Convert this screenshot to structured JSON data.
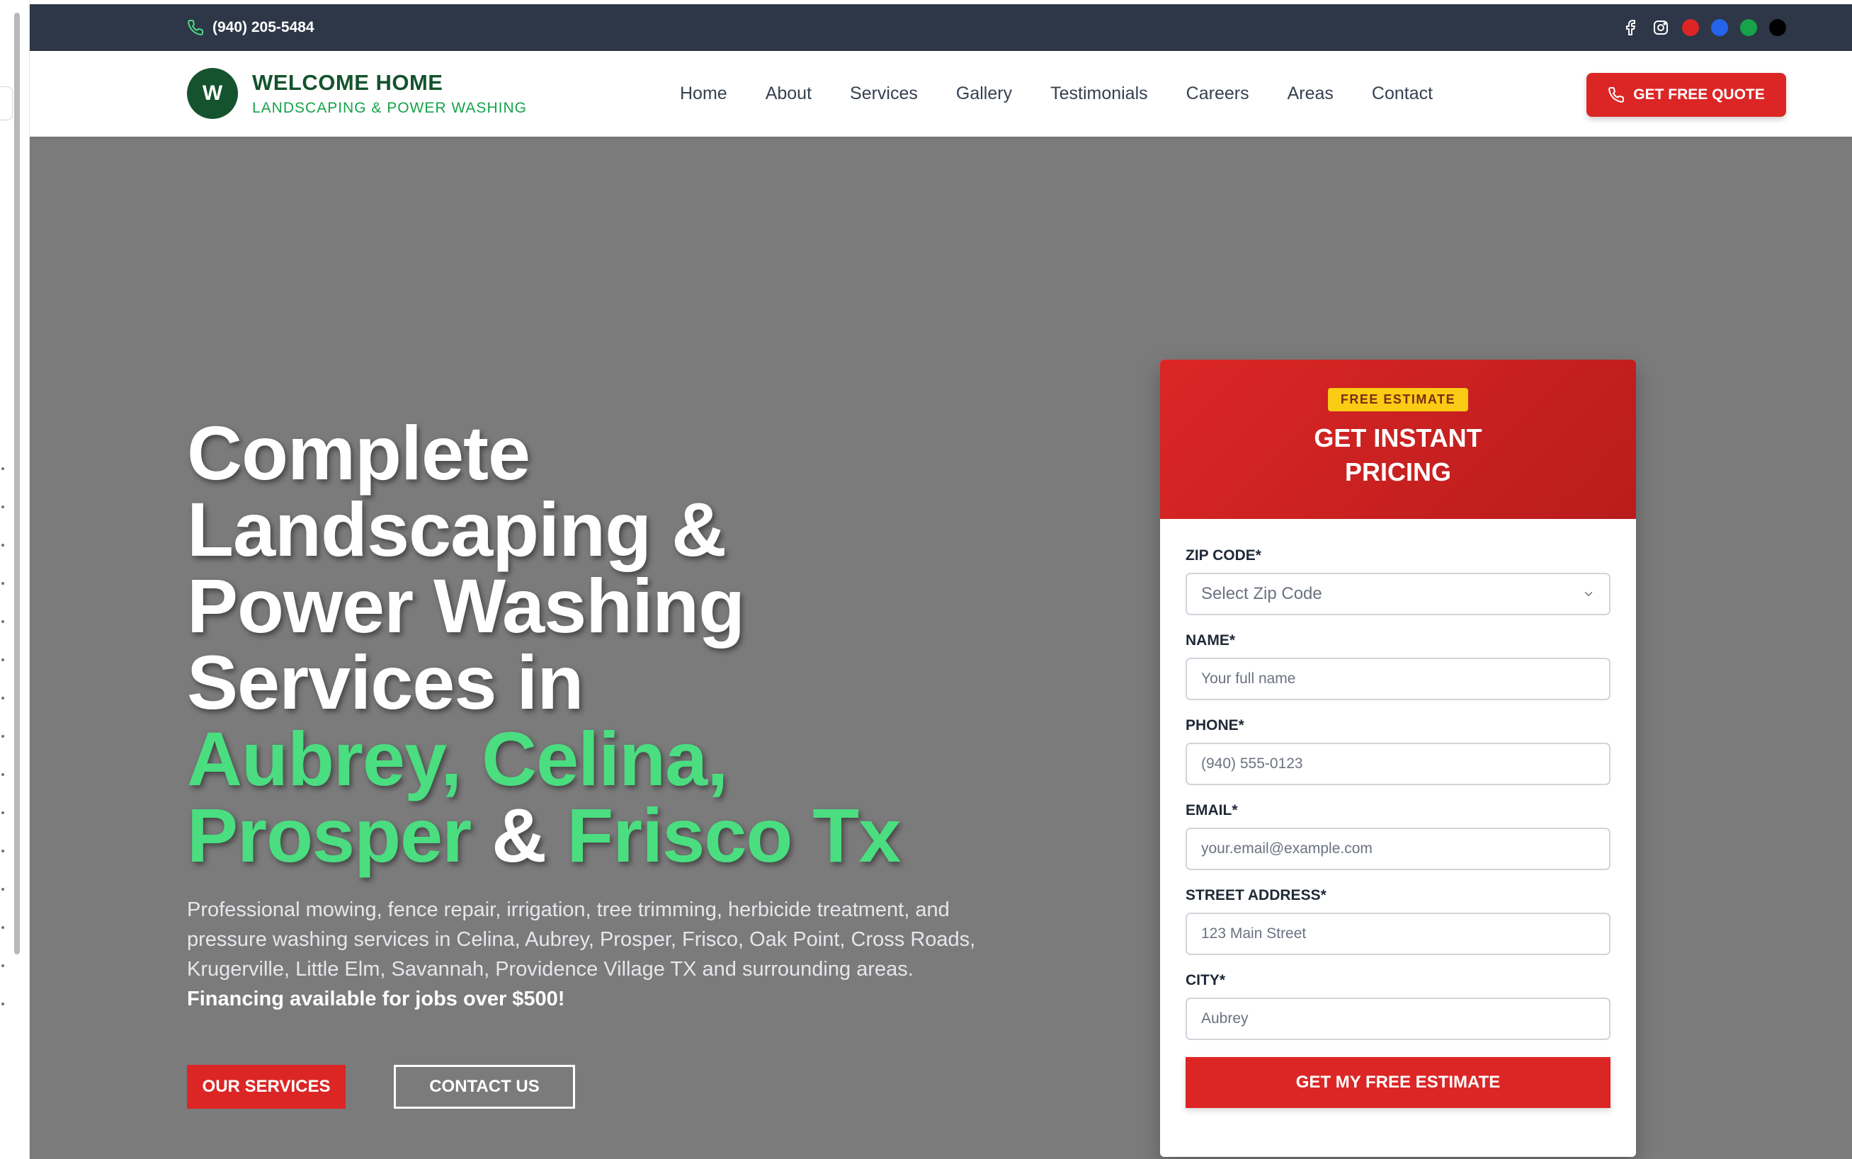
{
  "topbar": {
    "phone": "(940) 205-5484",
    "social": [
      {
        "name": "facebook-icon"
      },
      {
        "name": "instagram-icon"
      },
      {
        "name": "red-dot",
        "color": "#dc2626"
      },
      {
        "name": "blue-dot",
        "color": "#2563eb"
      },
      {
        "name": "green-dot",
        "color": "#16a34a"
      },
      {
        "name": "black-dot",
        "color": "#000000"
      }
    ]
  },
  "brand": {
    "initial": "W",
    "title": "WELCOME HOME",
    "subtitle": "LANDSCAPING & POWER WASHING"
  },
  "nav": {
    "items": [
      "Home",
      "About",
      "Services",
      "Gallery",
      "Testimonials",
      "Careers",
      "Areas",
      "Contact"
    ],
    "cta": "GET FREE QUOTE"
  },
  "hero": {
    "line1": "Complete",
    "line2": "Landscaping &",
    "line3": "Power Washing",
    "line4": "Services in",
    "green1": "Aubrey, Celina,",
    "green2": "Prosper",
    "amp": " & ",
    "green3": "Frisco Tx",
    "description": "Professional mowing, fence repair, irrigation, tree trimming, herbicide treatment, and pressure washing services in Celina, Aubrey, Prosper, Frisco, Oak Point, Cross Roads, Krugerville, Little Elm, Savannah, Providence Village TX and surrounding areas.",
    "financing": "Financing available for jobs over $500!",
    "btn_services": "OUR SERVICES",
    "btn_contact": "CONTACT US"
  },
  "estimate": {
    "badge": "FREE ESTIMATE",
    "title_line1": "GET INSTANT",
    "title_line2": "PRICING",
    "zip_label": "ZIP CODE*",
    "zip_placeholder": "Select Zip Code",
    "name_label": "NAME*",
    "name_placeholder": "Your full name",
    "phone_label": "PHONE*",
    "phone_placeholder": "(940) 555-0123",
    "email_label": "EMAIL*",
    "email_placeholder": "your.email@example.com",
    "street_label": "STREET ADDRESS*",
    "street_placeholder": "123 Main Street",
    "city_label": "CITY*",
    "city_placeholder": "Aubrey",
    "submit": "GET MY FREE ESTIMATE"
  },
  "colors": {
    "brand_green": "#14532d",
    "accent_green": "#4ade80",
    "accent_red": "#dc2626",
    "topbar": "#2d3748"
  }
}
